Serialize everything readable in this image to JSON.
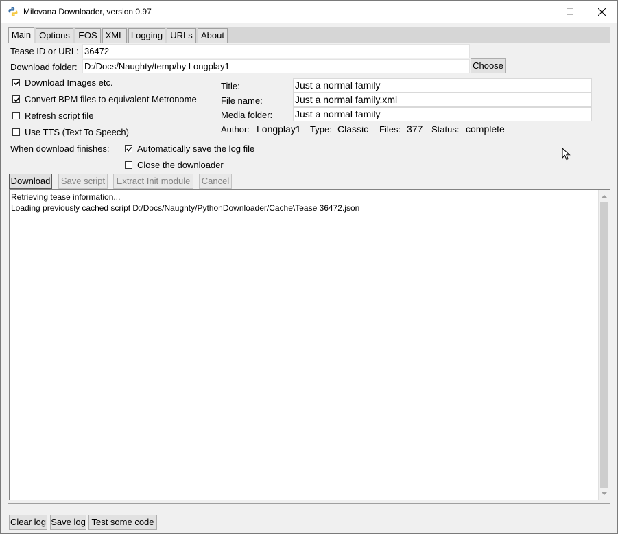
{
  "window": {
    "title": "Milovana Downloader, version 0.97"
  },
  "tabs": [
    {
      "label": "Main"
    },
    {
      "label": "Options"
    },
    {
      "label": "EOS"
    },
    {
      "label": "XML"
    },
    {
      "label": "Logging"
    },
    {
      "label": "URLs"
    },
    {
      "label": "About"
    }
  ],
  "main": {
    "tease_label": "Tease ID or URL:",
    "tease_value": "36472",
    "folder_label": "Download folder:",
    "folder_value": "D:/Docs/Naughty/temp/by Longplay1",
    "choose_label": "Choose",
    "options": [
      {
        "label": "Download Images etc.",
        "checked": true
      },
      {
        "label": "Convert BPM files to equivalent Metronome",
        "checked": true
      },
      {
        "label": "Refresh script file",
        "checked": false
      },
      {
        "label": "Use TTS (Text To Speech)",
        "checked": false
      }
    ],
    "finish_label": "When download finishes:",
    "finish_options": [
      {
        "label": "Automatically save the log file",
        "checked": true
      },
      {
        "label": "Close the downloader",
        "checked": false
      }
    ],
    "title_label": "Title:",
    "title_value": "Just a normal family",
    "filename_label": "File name:",
    "filename_value": "Just a normal family.xml",
    "media_label": "Media folder:",
    "media_value": "Just a normal family",
    "author_label": "Author:",
    "author_value": "Longplay1",
    "type_label": "Type:",
    "type_value": "Classic",
    "files_label": "Files:",
    "files_value": "377",
    "status_label": "Status:",
    "status_value": "complete",
    "buttons": {
      "download": "Download",
      "save_script": "Save script",
      "extract_init": "Extract Init module",
      "cancel": "Cancel"
    },
    "log_lines": [
      "Retrieving tease information...",
      "Loading previously cached script D:/Docs/Naughty/PythonDownloader/Cache\\Tease 36472.json"
    ]
  },
  "footer": {
    "clear_log": "Clear log",
    "save_log": "Save log",
    "test_code": "Test some code"
  }
}
